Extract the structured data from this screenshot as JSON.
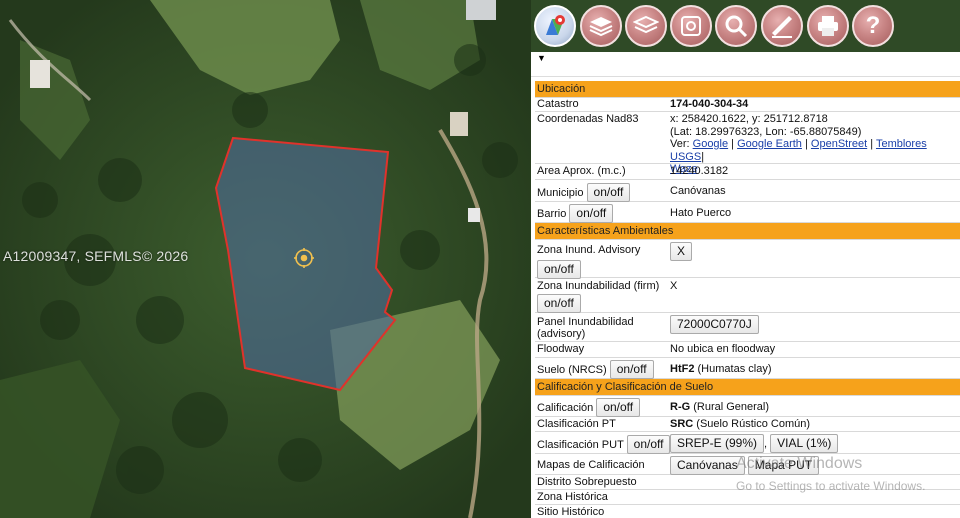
{
  "map": {
    "watermark": "A12009347, SEFMLS© 2026"
  },
  "toolbar": {
    "icons": [
      "maps-icon",
      "layers-icon",
      "layers-stack-icon",
      "gis-icon",
      "search-icon",
      "measure-icon",
      "print-icon",
      "help-icon"
    ]
  },
  "panel": {
    "dropdown_glyph": "▼",
    "sections": {
      "ubicacion": "Ubicación",
      "caracteristicas": "Características Ambientales",
      "calificacion": "Calificación y Clasificación de Suelo"
    },
    "catastro_label": "Catastro",
    "catastro_value": "174-040-304-34",
    "coords_label": "Coordenadas Nad83",
    "coords_xy": "x: 258420.1622, y: 251712.8718",
    "coords_latlon": "(Lat: 18.29976323, Lon: -65.88075849)",
    "ver_label": "Ver:",
    "links": [
      "Google",
      "Google Earth",
      "OpenStreet",
      "Temblores USGS",
      "Waze"
    ],
    "area_label": "Area Aprox. (m.c.)",
    "area_value": "14240.3182",
    "municipio_label": "Municipio",
    "municipio_value": "Canóvanas",
    "barrio_label": "Barrio",
    "barrio_value": "Hato Puerco",
    "onoff": "on/off",
    "zona_advisory_label": "Zona Inund. Advisory",
    "zona_advisory_value": "X",
    "zona_firm_label": "Zona Inundabilidad (firm)",
    "zona_firm_value": "X",
    "panel_inund_label": "Panel Inundabilidad (advisory)",
    "panel_inund_value": "72000C0770J",
    "floodway_label": "Floodway",
    "floodway_value": "No ubica en floodway",
    "suelo_label": "Suelo (NRCS)",
    "suelo_code": "HtF2",
    "suelo_desc": "(Humatas clay)",
    "calif_label": "Calificación",
    "calif_code": "R-G",
    "calif_desc": "(Rural General)",
    "clasif_pt_label": "Clasificación PT",
    "clasif_pt_code": "SRC",
    "clasif_pt_desc": "(Suelo Rústico Común)",
    "clasif_put_label": "Clasificación PUT",
    "clasif_put_b1": "SREP-E (99%)",
    "clasif_put_b2": "VIAL (1%)",
    "mapas_label": "Mapas de Calificación",
    "mapas_b1": "Canóvanas",
    "mapas_b2": "Mapa PUT",
    "distrito_label": "Distrito Sobrepuesto",
    "zona_hist_label": "Zona Histórica",
    "sitio_hist_label": "Sitio Histórico"
  },
  "os_overlay": {
    "line1": "Activate Windows",
    "line2": "Go to Settings to activate Windows."
  },
  "colors": {
    "section_bg": "#f6a21b",
    "parcel_stroke": "#e0322b",
    "link": "#1a3fa8"
  }
}
